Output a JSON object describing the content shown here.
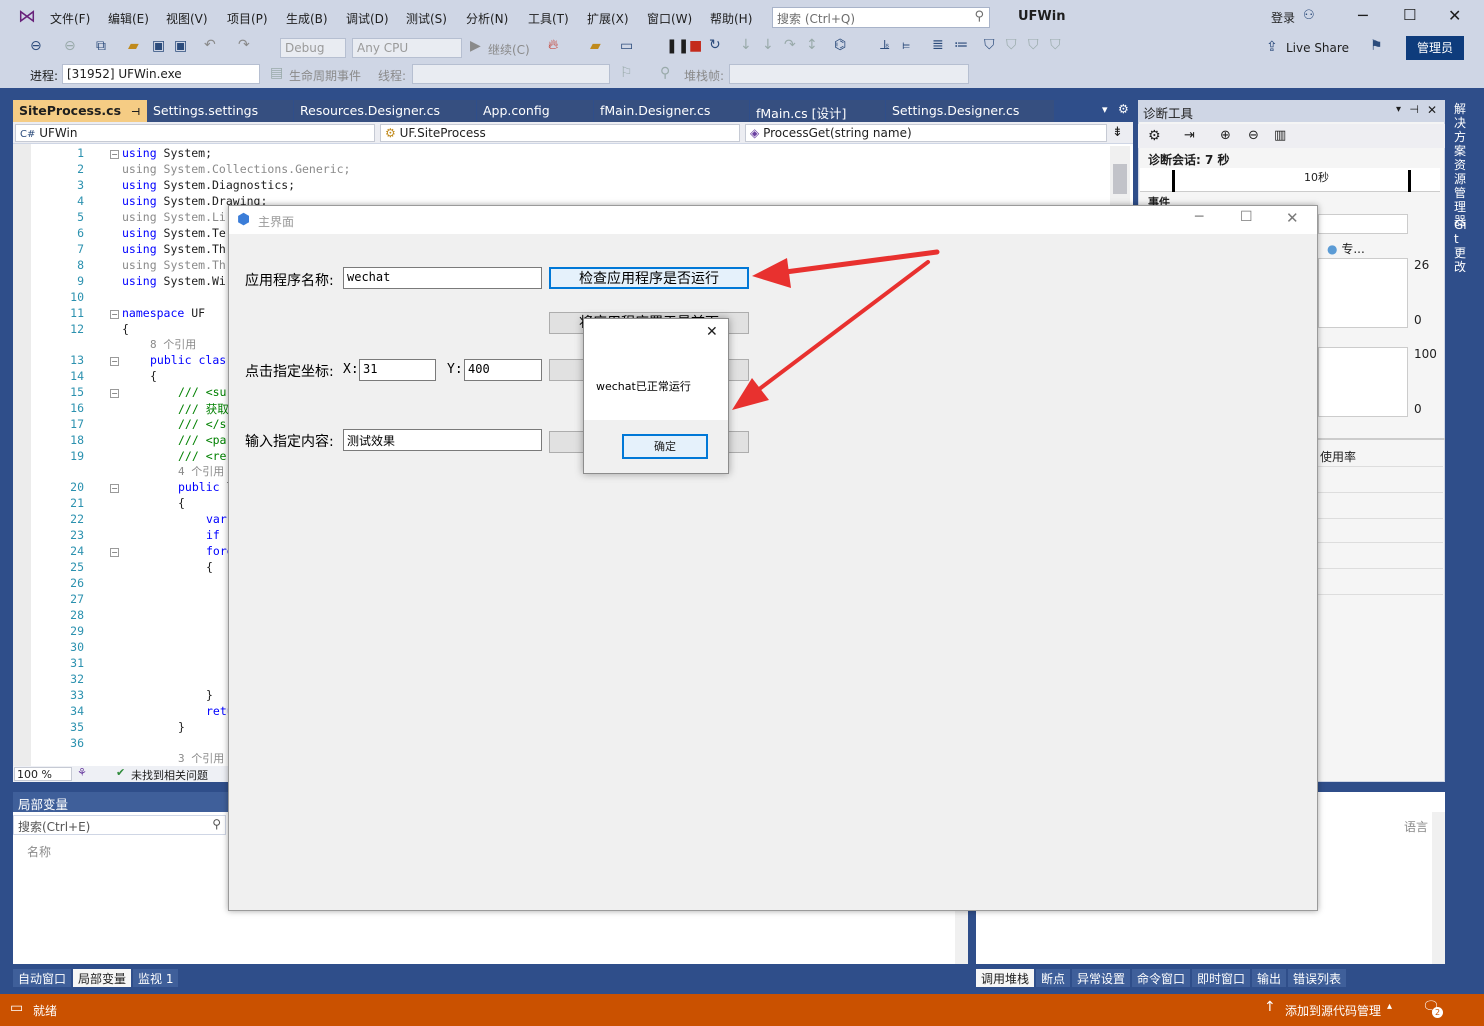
{
  "menu": {
    "items": [
      "文件(F)",
      "编辑(E)",
      "视图(V)",
      "项目(P)",
      "生成(B)",
      "调试(D)",
      "测试(S)",
      "分析(N)",
      "工具(T)",
      "扩展(X)",
      "窗口(W)",
      "帮助(H)"
    ],
    "search_placeholder": "搜索 (Ctrl+Q)",
    "solution_title": "UFWin",
    "login": "登录"
  },
  "toolbar": {
    "config": "Debug",
    "platform": "Any CPU",
    "continue": "继续(C)",
    "live_share": "Live Share",
    "admin": "管理员",
    "process_label": "进程:",
    "process_value": "[31952] UFWin.exe",
    "lifecycle": "生命周期事件",
    "thread_label": "线程:",
    "stackframe_label": "堆栈帧:"
  },
  "tabs": [
    "SiteProcess.cs",
    "Settings.settings",
    "Resources.Designer.cs",
    "App.config",
    "fMain.Designer.cs",
    "fMain.cs [设计]",
    "Settings.Designer.cs"
  ],
  "nav": {
    "project": "UFWin",
    "class": "UF.SiteProcess",
    "member": "ProcessGet(string name)"
  },
  "editor": {
    "line_numbers": [
      "1",
      "2",
      "3",
      "4",
      "5",
      "6",
      "7",
      "8",
      "9",
      "10",
      "11",
      "12",
      "",
      "13",
      "14",
      "15",
      "16",
      "17",
      "18",
      "19",
      "",
      "20",
      "21",
      "22",
      "23",
      "24",
      "25",
      "26",
      "27",
      "28",
      "29",
      "30",
      "31",
      "32",
      "33",
      "34",
      "35",
      "36"
    ],
    "ref_text_1": "8 个引用",
    "ref_text_2": "4 个引用",
    "ref_text_3": "3 个引用",
    "zoom": "100 %",
    "issues": "未找到相关问题"
  },
  "diagnostics": {
    "title": "诊断工具",
    "session": "诊断会话: 7 秒",
    "tick": "10秒",
    "events": "事件",
    "legend": "专...",
    "mem_max": "26",
    "mem_min": "0",
    "cpu_max": "100",
    "cpu_min": "0",
    "usage": "使用率"
  },
  "side_tabs": [
    "解决方案资源管理器",
    "Git 更改"
  ],
  "locals": {
    "title": "局部变量",
    "search_placeholder": "搜索(Ctrl+E)",
    "col_name": "名称",
    "col_lang": "语言",
    "tabs": [
      "自动窗口",
      "局部变量",
      "监视 1"
    ]
  },
  "callstack": {
    "tabs": [
      "调用堆栈",
      "断点",
      "异常设置",
      "命令窗口",
      "即时窗口",
      "输出",
      "错误列表"
    ]
  },
  "status": {
    "ready": "就绪",
    "source_control": "添加到源代码管理",
    "notifications": "2"
  },
  "form": {
    "title": "主界面",
    "app_label": "应用程序名称:",
    "app_value": "wechat",
    "check_button": "检查应用程序是否运行",
    "bring_front_button": "将应用程序置于最前面",
    "coord_label": "点击指定坐标:",
    "x_label": "X:",
    "x_value": "31",
    "y_label": "Y:",
    "y_value": "400",
    "content_label": "输入指定内容:",
    "content_value": "测试效果"
  },
  "msgbox": {
    "message": "wechat已正常运行",
    "ok": "确定"
  },
  "colors": {
    "vs_blue": "#2f4e8a",
    "tab_active": "#f5cc84",
    "status_orange": "#ca5100",
    "arrow_red": "#e8312f",
    "focus_blue": "#0078d7"
  }
}
